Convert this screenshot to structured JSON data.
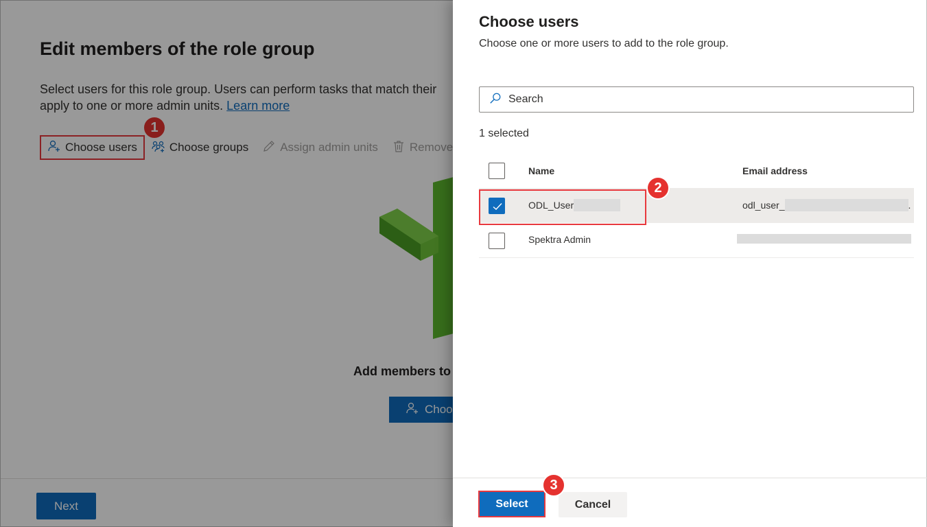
{
  "background": {
    "title": "Edit members of the role group",
    "description_line1": "Select users for this role group. Users can perform tasks that match their",
    "description_line2": "apply to one or more admin units.",
    "learn_more": "Learn more",
    "toolbar": {
      "choose_users": "Choose users",
      "choose_groups": "Choose groups",
      "assign_admin_units": "Assign admin units",
      "remove": "Remove"
    },
    "empty_state": {
      "title": "Add members to",
      "button": "Choo"
    },
    "next_button": "Next"
  },
  "panel": {
    "title": "Choose users",
    "subtitle": "Choose one or more users to add to the role group.",
    "search_placeholder": "Search",
    "selected_count": "1 selected",
    "columns": {
      "name": "Name",
      "email": "Email address"
    },
    "rows": [
      {
        "name": "ODL_User",
        "email": "odl_user_",
        "email_suffix": ".",
        "checked": true
      },
      {
        "name": "Spektra Admin",
        "email": "",
        "checked": false
      }
    ],
    "select_button": "Select",
    "cancel_button": "Cancel"
  },
  "annotations": {
    "step1": "1",
    "step2": "2",
    "step3": "3"
  },
  "colors": {
    "accent": "#0f6cbd",
    "highlight": "#e8383d",
    "badge": "#e5322f"
  }
}
